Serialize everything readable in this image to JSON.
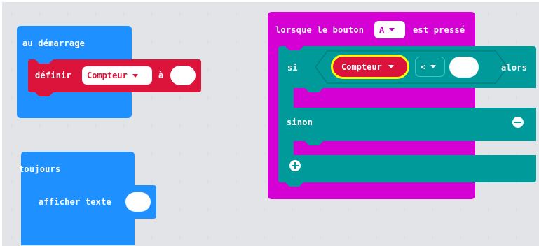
{
  "colors": {
    "workspace_bg": "#f6f7f8",
    "basic_blue": "#1e90ff",
    "variable_red": "#dc143c",
    "input_magenta": "#d400d4",
    "logic_teal": "#009a9a",
    "highlight_yellow": "#ffff00"
  },
  "on_start": {
    "title": "au démarrage",
    "set_block": {
      "keyword": "définir",
      "variable": "Compteur",
      "to": "à"
    }
  },
  "forever": {
    "title": "toujours",
    "show_block": {
      "label": "afficher texte"
    }
  },
  "button_event": {
    "prefix": "lorsque le bouton",
    "button": "A",
    "suffix": "est pressé",
    "if_block": {
      "if_label": "si",
      "variable": "Compteur",
      "operator": "<",
      "then_label": "alors",
      "else_label": "sinon",
      "remove_icon": "minus-circle-icon",
      "add_icon": "plus-circle-icon"
    }
  }
}
